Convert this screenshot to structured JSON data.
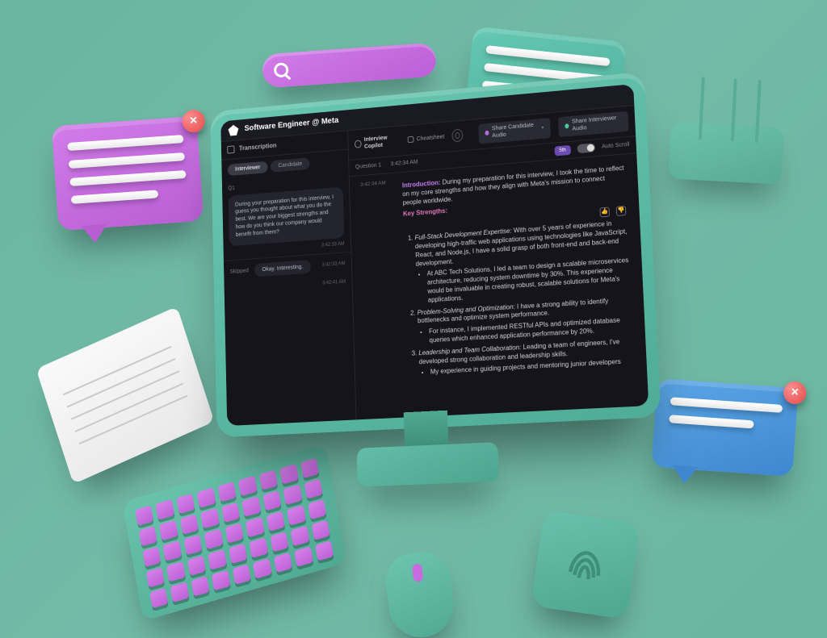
{
  "app": {
    "title": "Software Engineer @ Meta"
  },
  "left": {
    "section_label": "Transcription",
    "tabs": {
      "interviewer": "Interviewer",
      "candidate": "Candidate"
    },
    "q1": {
      "code": "Q1",
      "text": "During your preparation for this interview, I guess you thought about what you do the best. We are your biggest strengths and how do you think our company would benefit from them?",
      "time": "3:42:33 AM"
    },
    "skipped": {
      "label": "Skipped",
      "chip": "Okay. Interesting.",
      "time": "3:42:33 AM"
    },
    "extra_time": "3:42:41 AM"
  },
  "copilot": {
    "label": "Interview Copilot",
    "cheatsheet": "Cheatsheet",
    "share_candidate": "Share Candidate Audio",
    "share_interviewer": "Share Interviewer Audio",
    "question_label": "Question 1",
    "question_time": "3:42:34 AM",
    "badge": "5th",
    "auto_scroll": "Auto Scroll",
    "answer_time": "3:42:34 AM"
  },
  "answer": {
    "intro_label": "Introduction:",
    "intro_body": "During my preparation for this interview, I took the time to reflect on my core strengths and how they align with Meta's mission to connect people worldwide.",
    "key_label": "Key Strengths:",
    "s1_title": "Full-Stack Development Expertise:",
    "s1_body": "With over 5 years of experience in developing high-traffic web applications using technologies like JavaScript, React, and Node.js, I have a solid grasp of both front-end and back-end development.",
    "s1_bullet": "At ABC Tech Solutions, I led a team to design a scalable microservices architecture, reducing system downtime by 30%. This experience would be invaluable in creating robust, scalable solutions for Meta's applications.",
    "s2_title": "Problem-Solving and Optimization:",
    "s2_body": "I have a strong ability to identify bottlenecks and optimize system performance.",
    "s2_bullet": "For instance, I implemented RESTful APIs and optimized database queries which enhanced application performance by 20%.",
    "s3_title": "Leadership and Team Collaboration:",
    "s3_body": "Leading a team of engineers, I've developed strong collaboration and leadership skills.",
    "s3_bullet": "My experience in guiding projects and mentoring junior developers"
  }
}
